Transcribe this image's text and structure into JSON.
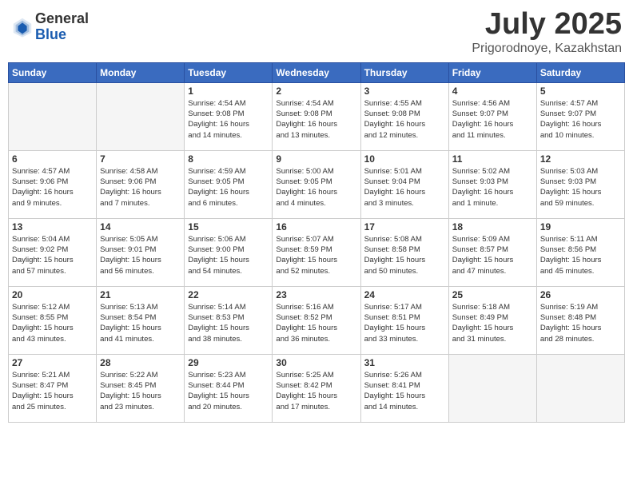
{
  "header": {
    "logo_general": "General",
    "logo_blue": "Blue",
    "month_year": "July 2025",
    "location": "Prigorodnoye, Kazakhstan"
  },
  "weekdays": [
    "Sunday",
    "Monday",
    "Tuesday",
    "Wednesday",
    "Thursday",
    "Friday",
    "Saturday"
  ],
  "weeks": [
    [
      {
        "day": "",
        "info": ""
      },
      {
        "day": "",
        "info": ""
      },
      {
        "day": "1",
        "info": "Sunrise: 4:54 AM\nSunset: 9:08 PM\nDaylight: 16 hours\nand 14 minutes."
      },
      {
        "day": "2",
        "info": "Sunrise: 4:54 AM\nSunset: 9:08 PM\nDaylight: 16 hours\nand 13 minutes."
      },
      {
        "day": "3",
        "info": "Sunrise: 4:55 AM\nSunset: 9:08 PM\nDaylight: 16 hours\nand 12 minutes."
      },
      {
        "day": "4",
        "info": "Sunrise: 4:56 AM\nSunset: 9:07 PM\nDaylight: 16 hours\nand 11 minutes."
      },
      {
        "day": "5",
        "info": "Sunrise: 4:57 AM\nSunset: 9:07 PM\nDaylight: 16 hours\nand 10 minutes."
      }
    ],
    [
      {
        "day": "6",
        "info": "Sunrise: 4:57 AM\nSunset: 9:06 PM\nDaylight: 16 hours\nand 9 minutes."
      },
      {
        "day": "7",
        "info": "Sunrise: 4:58 AM\nSunset: 9:06 PM\nDaylight: 16 hours\nand 7 minutes."
      },
      {
        "day": "8",
        "info": "Sunrise: 4:59 AM\nSunset: 9:05 PM\nDaylight: 16 hours\nand 6 minutes."
      },
      {
        "day": "9",
        "info": "Sunrise: 5:00 AM\nSunset: 9:05 PM\nDaylight: 16 hours\nand 4 minutes."
      },
      {
        "day": "10",
        "info": "Sunrise: 5:01 AM\nSunset: 9:04 PM\nDaylight: 16 hours\nand 3 minutes."
      },
      {
        "day": "11",
        "info": "Sunrise: 5:02 AM\nSunset: 9:03 PM\nDaylight: 16 hours\nand 1 minute."
      },
      {
        "day": "12",
        "info": "Sunrise: 5:03 AM\nSunset: 9:03 PM\nDaylight: 15 hours\nand 59 minutes."
      }
    ],
    [
      {
        "day": "13",
        "info": "Sunrise: 5:04 AM\nSunset: 9:02 PM\nDaylight: 15 hours\nand 57 minutes."
      },
      {
        "day": "14",
        "info": "Sunrise: 5:05 AM\nSunset: 9:01 PM\nDaylight: 15 hours\nand 56 minutes."
      },
      {
        "day": "15",
        "info": "Sunrise: 5:06 AM\nSunset: 9:00 PM\nDaylight: 15 hours\nand 54 minutes."
      },
      {
        "day": "16",
        "info": "Sunrise: 5:07 AM\nSunset: 8:59 PM\nDaylight: 15 hours\nand 52 minutes."
      },
      {
        "day": "17",
        "info": "Sunrise: 5:08 AM\nSunset: 8:58 PM\nDaylight: 15 hours\nand 50 minutes."
      },
      {
        "day": "18",
        "info": "Sunrise: 5:09 AM\nSunset: 8:57 PM\nDaylight: 15 hours\nand 47 minutes."
      },
      {
        "day": "19",
        "info": "Sunrise: 5:11 AM\nSunset: 8:56 PM\nDaylight: 15 hours\nand 45 minutes."
      }
    ],
    [
      {
        "day": "20",
        "info": "Sunrise: 5:12 AM\nSunset: 8:55 PM\nDaylight: 15 hours\nand 43 minutes."
      },
      {
        "day": "21",
        "info": "Sunrise: 5:13 AM\nSunset: 8:54 PM\nDaylight: 15 hours\nand 41 minutes."
      },
      {
        "day": "22",
        "info": "Sunrise: 5:14 AM\nSunset: 8:53 PM\nDaylight: 15 hours\nand 38 minutes."
      },
      {
        "day": "23",
        "info": "Sunrise: 5:16 AM\nSunset: 8:52 PM\nDaylight: 15 hours\nand 36 minutes."
      },
      {
        "day": "24",
        "info": "Sunrise: 5:17 AM\nSunset: 8:51 PM\nDaylight: 15 hours\nand 33 minutes."
      },
      {
        "day": "25",
        "info": "Sunrise: 5:18 AM\nSunset: 8:49 PM\nDaylight: 15 hours\nand 31 minutes."
      },
      {
        "day": "26",
        "info": "Sunrise: 5:19 AM\nSunset: 8:48 PM\nDaylight: 15 hours\nand 28 minutes."
      }
    ],
    [
      {
        "day": "27",
        "info": "Sunrise: 5:21 AM\nSunset: 8:47 PM\nDaylight: 15 hours\nand 25 minutes."
      },
      {
        "day": "28",
        "info": "Sunrise: 5:22 AM\nSunset: 8:45 PM\nDaylight: 15 hours\nand 23 minutes."
      },
      {
        "day": "29",
        "info": "Sunrise: 5:23 AM\nSunset: 8:44 PM\nDaylight: 15 hours\nand 20 minutes."
      },
      {
        "day": "30",
        "info": "Sunrise: 5:25 AM\nSunset: 8:42 PM\nDaylight: 15 hours\nand 17 minutes."
      },
      {
        "day": "31",
        "info": "Sunrise: 5:26 AM\nSunset: 8:41 PM\nDaylight: 15 hours\nand 14 minutes."
      },
      {
        "day": "",
        "info": ""
      },
      {
        "day": "",
        "info": ""
      }
    ]
  ]
}
